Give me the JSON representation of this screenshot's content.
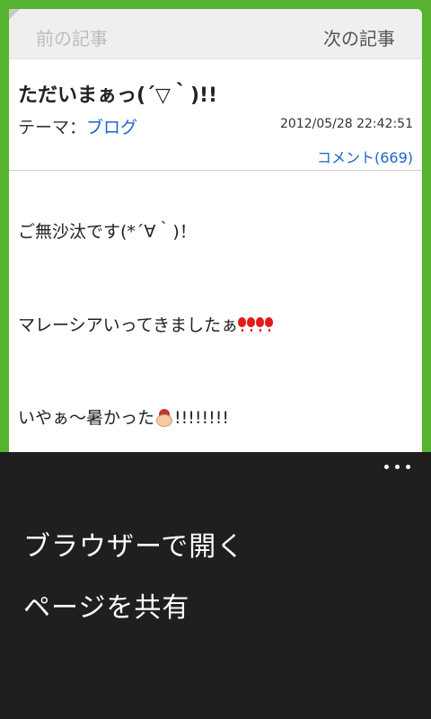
{
  "nav": {
    "prev_label": "前の記事",
    "next_label": "次の記事"
  },
  "article": {
    "title": "ただいまぁっ(´▽｀)!!",
    "theme_prefix": "テーマ：",
    "theme_link": "ブログ",
    "date": "2012/05/28 22:42:51",
    "comment_link": "コメント(669)",
    "paragraphs": [
      "ご無沙汰です(*´∀｀)！",
      "マレーシアいってきましたぁ",
      "いやぁ〜暑かった"
    ],
    "para3_suffix": "!!!!!!!!",
    "emoji": [
      "red-exclamation-icon",
      "sweating-face-icon"
    ]
  },
  "menu": {
    "items": [
      "ブラウザーで開く",
      "ページを共有"
    ]
  },
  "colors": {
    "background_green": "#56b22f",
    "link_blue": "#1a66c7",
    "menu_bg": "#1f1f1f"
  }
}
